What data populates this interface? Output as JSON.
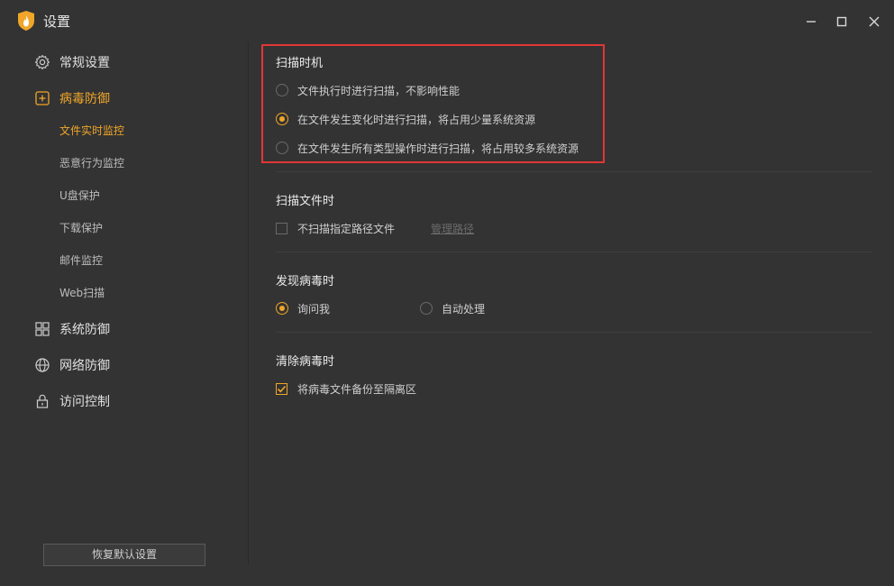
{
  "window": {
    "title": "设置",
    "icons": {
      "logo": "shield-flame-icon",
      "minimize": "minimize-icon",
      "maximize": "maximize-icon",
      "close": "close-icon"
    }
  },
  "sidebar": {
    "items": [
      {
        "label": "常规设置",
        "icon": "gear-icon"
      },
      {
        "label": "病毒防御",
        "icon": "plus-square-icon",
        "active": true
      },
      {
        "label": "系统防御",
        "icon": "grid-icon"
      },
      {
        "label": "网络防御",
        "icon": "globe-icon"
      },
      {
        "label": "访问控制",
        "icon": "lock-icon"
      }
    ],
    "subitems": [
      {
        "label": "文件实时监控",
        "active": true
      },
      {
        "label": "恶意行为监控"
      },
      {
        "label": "U盘保护"
      },
      {
        "label": "下载保护"
      },
      {
        "label": "邮件监控"
      },
      {
        "label": "Web扫描"
      }
    ],
    "restore_label": "恢复默认设置"
  },
  "main": {
    "scan_timing": {
      "title": "扫描时机",
      "options": [
        {
          "label": "文件执行时进行扫描，不影响性能",
          "checked": false
        },
        {
          "label": "在文件发生变化时进行扫描，将占用少量系统资源",
          "checked": true
        },
        {
          "label": "在文件发生所有类型操作时进行扫描，将占用较多系统资源",
          "checked": false
        }
      ]
    },
    "scan_files": {
      "title": "扫描文件时",
      "checkbox_label": "不扫描指定路径文件",
      "checked": false,
      "link_label": "管理路径"
    },
    "virus_found": {
      "title": "发现病毒时",
      "options": [
        {
          "label": "询问我",
          "checked": true
        },
        {
          "label": "自动处理",
          "checked": false
        }
      ]
    },
    "virus_clean": {
      "title": "清除病毒时",
      "checkbox_label": "将病毒文件备份至隔离区",
      "checked": true
    }
  },
  "colors": {
    "accent": "#f0a629",
    "background": "#333333",
    "highlight": "#e23636"
  }
}
